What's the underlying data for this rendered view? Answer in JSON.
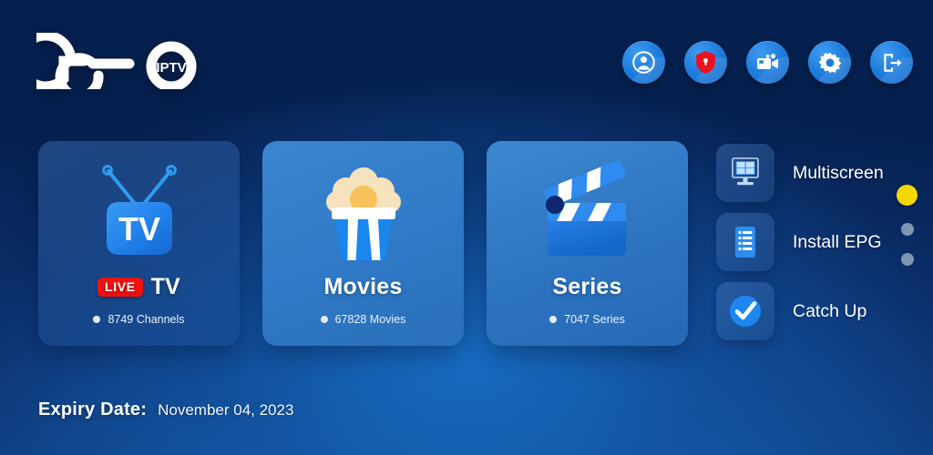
{
  "app": {
    "brand_name": "Geo",
    "brand_sub": "IPTV"
  },
  "colors": {
    "accent_blue": "#1f7ddd",
    "live_red": "#ef1111",
    "active_dot": "#f3d800",
    "idle_dot": "#93a7bf",
    "background_navy": "#0b2f6b"
  },
  "header": {
    "icons": [
      {
        "name": "account-icon",
        "label": "Account"
      },
      {
        "name": "shield-icon",
        "label": "Protection"
      },
      {
        "name": "video-camera-icon",
        "label": "Recordings"
      },
      {
        "name": "gear-icon",
        "label": "Settings"
      },
      {
        "name": "logout-icon",
        "label": "Logout"
      }
    ]
  },
  "cards": [
    {
      "id": "live-tv",
      "title": "TV",
      "badge": "LIVE",
      "count_text": "8749 Channels",
      "icon": "tv-icon"
    },
    {
      "id": "movies",
      "title": "Movies",
      "badge": "",
      "count_text": "67828 Movies",
      "icon": "popcorn-icon"
    },
    {
      "id": "series",
      "title": "Series",
      "badge": "",
      "count_text": "7047 Series",
      "icon": "clapperboard-icon"
    }
  ],
  "side_menu": [
    {
      "id": "multiscreen",
      "label": "Multiscreen",
      "icon": "multiscreen-icon"
    },
    {
      "id": "install-epg",
      "label": "Install EPG",
      "icon": "list-icon"
    },
    {
      "id": "catch-up",
      "label": "Catch Up",
      "icon": "check-circle-icon"
    }
  ],
  "pagination": {
    "total": 3,
    "active_index": 0
  },
  "footer": {
    "expiry_label": "Expiry Date:",
    "expiry_value": "November 04, 2023"
  }
}
